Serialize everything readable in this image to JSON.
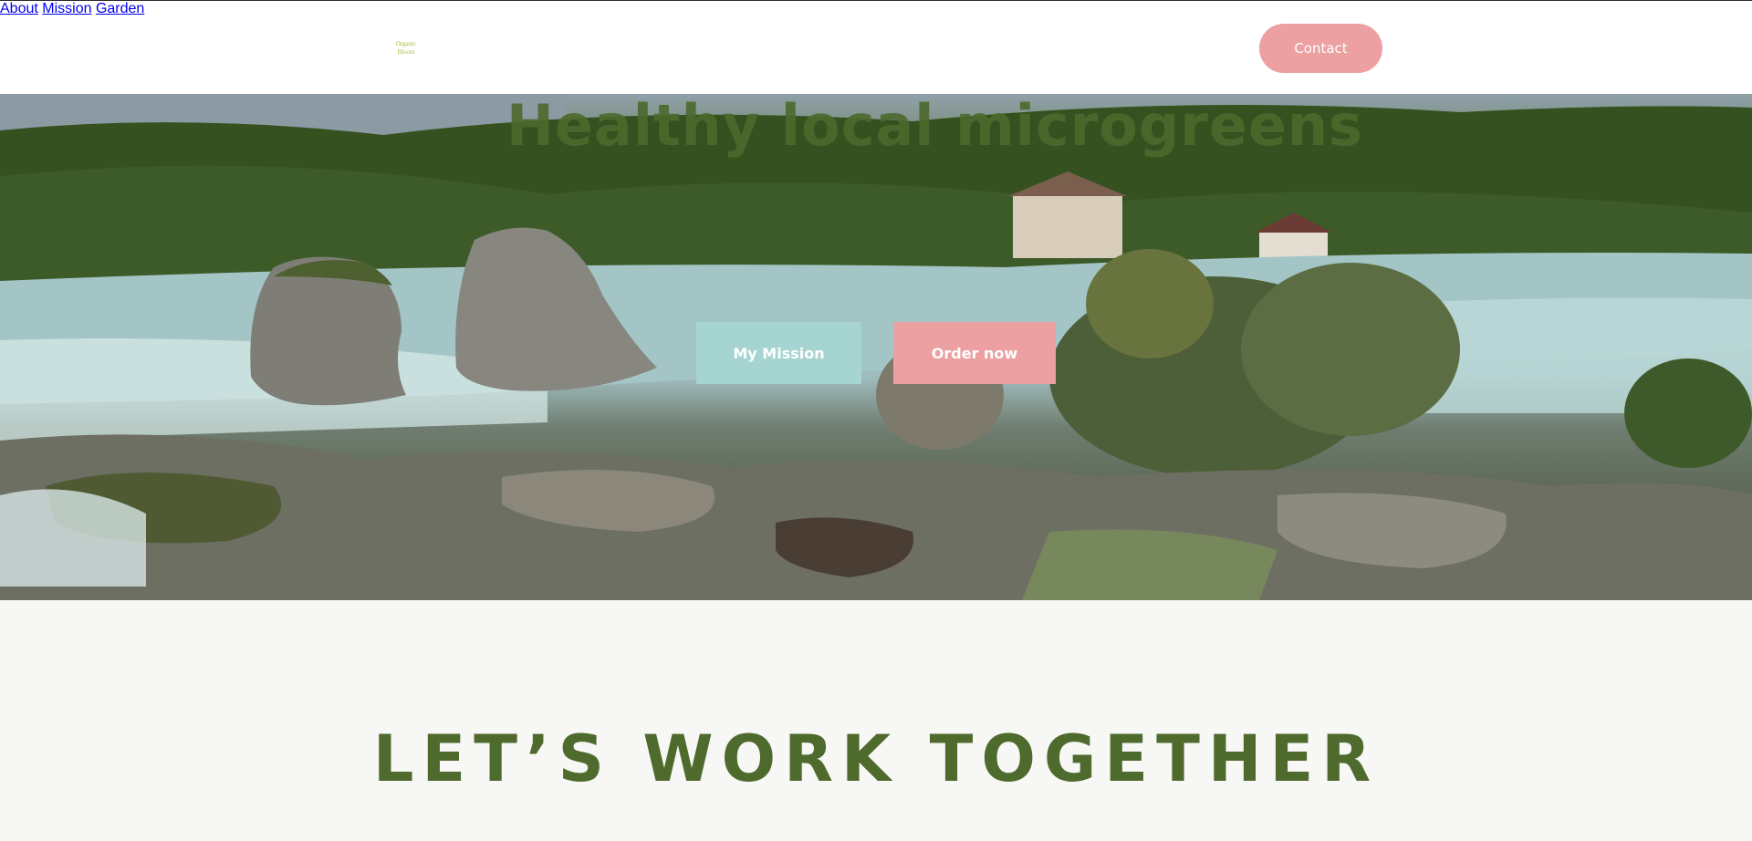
{
  "header": {
    "logo_line1": "Organic",
    "logo_line2": "Bloom",
    "nav": [
      "About",
      "Mission",
      "Garden"
    ],
    "contact_label": "Contact"
  },
  "hero": {
    "title": "Healthy local microgreens",
    "mission_button": "My Mission",
    "order_button": "Order now"
  },
  "section": {
    "title": "LET’S WORK TOGETHER"
  },
  "colors": {
    "accent_pink": "#eca0a2",
    "accent_teal": "#a6d4d0",
    "brand_green": "#4e6a2c",
    "nav_text": "#2a3550"
  }
}
